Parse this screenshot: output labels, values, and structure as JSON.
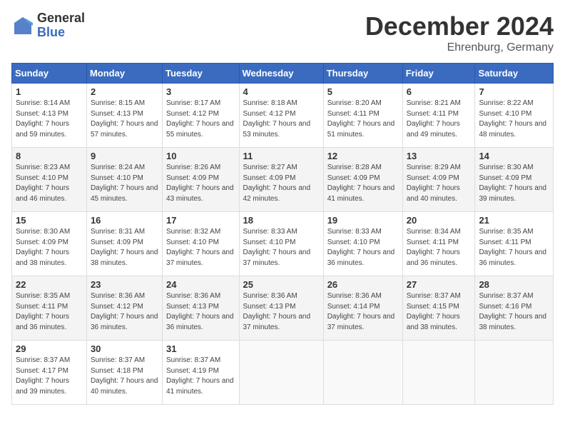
{
  "logo": {
    "general": "General",
    "blue": "Blue"
  },
  "title": "December 2024",
  "subtitle": "Ehrenburg, Germany",
  "days_header": [
    "Sunday",
    "Monday",
    "Tuesday",
    "Wednesday",
    "Thursday",
    "Friday",
    "Saturday"
  ],
  "weeks": [
    [
      {
        "day": "1",
        "sunrise": "Sunrise: 8:14 AM",
        "sunset": "Sunset: 4:13 PM",
        "daylight": "Daylight: 7 hours and 59 minutes."
      },
      {
        "day": "2",
        "sunrise": "Sunrise: 8:15 AM",
        "sunset": "Sunset: 4:13 PM",
        "daylight": "Daylight: 7 hours and 57 minutes."
      },
      {
        "day": "3",
        "sunrise": "Sunrise: 8:17 AM",
        "sunset": "Sunset: 4:12 PM",
        "daylight": "Daylight: 7 hours and 55 minutes."
      },
      {
        "day": "4",
        "sunrise": "Sunrise: 8:18 AM",
        "sunset": "Sunset: 4:12 PM",
        "daylight": "Daylight: 7 hours and 53 minutes."
      },
      {
        "day": "5",
        "sunrise": "Sunrise: 8:20 AM",
        "sunset": "Sunset: 4:11 PM",
        "daylight": "Daylight: 7 hours and 51 minutes."
      },
      {
        "day": "6",
        "sunrise": "Sunrise: 8:21 AM",
        "sunset": "Sunset: 4:11 PM",
        "daylight": "Daylight: 7 hours and 49 minutes."
      },
      {
        "day": "7",
        "sunrise": "Sunrise: 8:22 AM",
        "sunset": "Sunset: 4:10 PM",
        "daylight": "Daylight: 7 hours and 48 minutes."
      }
    ],
    [
      {
        "day": "8",
        "sunrise": "Sunrise: 8:23 AM",
        "sunset": "Sunset: 4:10 PM",
        "daylight": "Daylight: 7 hours and 46 minutes."
      },
      {
        "day": "9",
        "sunrise": "Sunrise: 8:24 AM",
        "sunset": "Sunset: 4:10 PM",
        "daylight": "Daylight: 7 hours and 45 minutes."
      },
      {
        "day": "10",
        "sunrise": "Sunrise: 8:26 AM",
        "sunset": "Sunset: 4:09 PM",
        "daylight": "Daylight: 7 hours and 43 minutes."
      },
      {
        "day": "11",
        "sunrise": "Sunrise: 8:27 AM",
        "sunset": "Sunset: 4:09 PM",
        "daylight": "Daylight: 7 hours and 42 minutes."
      },
      {
        "day": "12",
        "sunrise": "Sunrise: 8:28 AM",
        "sunset": "Sunset: 4:09 PM",
        "daylight": "Daylight: 7 hours and 41 minutes."
      },
      {
        "day": "13",
        "sunrise": "Sunrise: 8:29 AM",
        "sunset": "Sunset: 4:09 PM",
        "daylight": "Daylight: 7 hours and 40 minutes."
      },
      {
        "day": "14",
        "sunrise": "Sunrise: 8:30 AM",
        "sunset": "Sunset: 4:09 PM",
        "daylight": "Daylight: 7 hours and 39 minutes."
      }
    ],
    [
      {
        "day": "15",
        "sunrise": "Sunrise: 8:30 AM",
        "sunset": "Sunset: 4:09 PM",
        "daylight": "Daylight: 7 hours and 38 minutes."
      },
      {
        "day": "16",
        "sunrise": "Sunrise: 8:31 AM",
        "sunset": "Sunset: 4:09 PM",
        "daylight": "Daylight: 7 hours and 38 minutes."
      },
      {
        "day": "17",
        "sunrise": "Sunrise: 8:32 AM",
        "sunset": "Sunset: 4:10 PM",
        "daylight": "Daylight: 7 hours and 37 minutes."
      },
      {
        "day": "18",
        "sunrise": "Sunrise: 8:33 AM",
        "sunset": "Sunset: 4:10 PM",
        "daylight": "Daylight: 7 hours and 37 minutes."
      },
      {
        "day": "19",
        "sunrise": "Sunrise: 8:33 AM",
        "sunset": "Sunset: 4:10 PM",
        "daylight": "Daylight: 7 hours and 36 minutes."
      },
      {
        "day": "20",
        "sunrise": "Sunrise: 8:34 AM",
        "sunset": "Sunset: 4:11 PM",
        "daylight": "Daylight: 7 hours and 36 minutes."
      },
      {
        "day": "21",
        "sunrise": "Sunrise: 8:35 AM",
        "sunset": "Sunset: 4:11 PM",
        "daylight": "Daylight: 7 hours and 36 minutes."
      }
    ],
    [
      {
        "day": "22",
        "sunrise": "Sunrise: 8:35 AM",
        "sunset": "Sunset: 4:11 PM",
        "daylight": "Daylight: 7 hours and 36 minutes."
      },
      {
        "day": "23",
        "sunrise": "Sunrise: 8:36 AM",
        "sunset": "Sunset: 4:12 PM",
        "daylight": "Daylight: 7 hours and 36 minutes."
      },
      {
        "day": "24",
        "sunrise": "Sunrise: 8:36 AM",
        "sunset": "Sunset: 4:13 PM",
        "daylight": "Daylight: 7 hours and 36 minutes."
      },
      {
        "day": "25",
        "sunrise": "Sunrise: 8:36 AM",
        "sunset": "Sunset: 4:13 PM",
        "daylight": "Daylight: 7 hours and 37 minutes."
      },
      {
        "day": "26",
        "sunrise": "Sunrise: 8:36 AM",
        "sunset": "Sunset: 4:14 PM",
        "daylight": "Daylight: 7 hours and 37 minutes."
      },
      {
        "day": "27",
        "sunrise": "Sunrise: 8:37 AM",
        "sunset": "Sunset: 4:15 PM",
        "daylight": "Daylight: 7 hours and 38 minutes."
      },
      {
        "day": "28",
        "sunrise": "Sunrise: 8:37 AM",
        "sunset": "Sunset: 4:16 PM",
        "daylight": "Daylight: 7 hours and 38 minutes."
      }
    ],
    [
      {
        "day": "29",
        "sunrise": "Sunrise: 8:37 AM",
        "sunset": "Sunset: 4:17 PM",
        "daylight": "Daylight: 7 hours and 39 minutes."
      },
      {
        "day": "30",
        "sunrise": "Sunrise: 8:37 AM",
        "sunset": "Sunset: 4:18 PM",
        "daylight": "Daylight: 7 hours and 40 minutes."
      },
      {
        "day": "31",
        "sunrise": "Sunrise: 8:37 AM",
        "sunset": "Sunset: 4:19 PM",
        "daylight": "Daylight: 7 hours and 41 minutes."
      },
      null,
      null,
      null,
      null
    ]
  ]
}
